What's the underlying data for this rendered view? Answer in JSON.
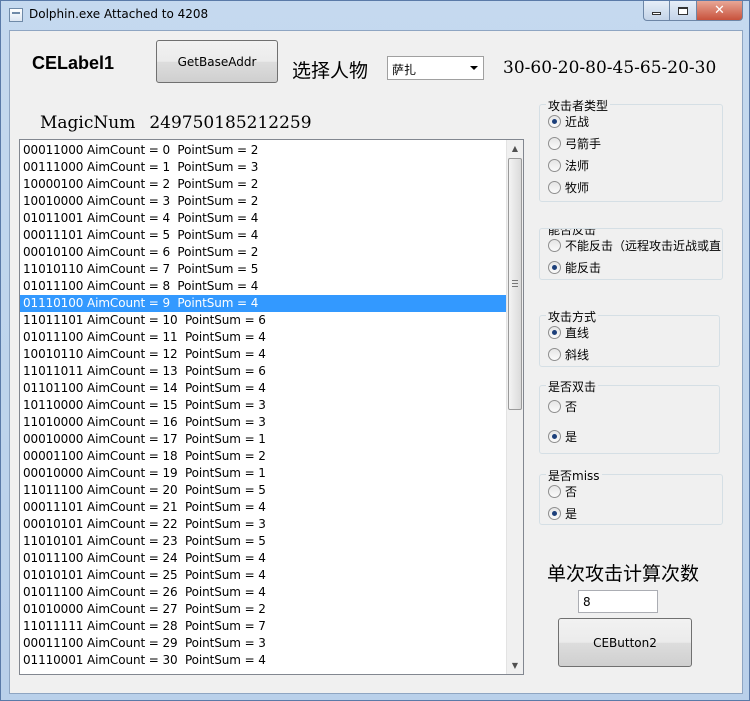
{
  "window": {
    "title": "Dolphin.exe Attached to 4208"
  },
  "header": {
    "celabel": "CELabel1",
    "getbase_button": "GetBaseAddr",
    "select_label": "选择人物",
    "combo_value": "萨扎",
    "number_string": "30-60-20-80-45-65-20-30"
  },
  "magic": {
    "label": "MagicNum",
    "value": "249750185212259"
  },
  "list": {
    "selected_index": 9,
    "rows": [
      "00011000 AimCount = 0  PointSum = 2",
      "00111000 AimCount = 1  PointSum = 3",
      "10000100 AimCount = 2  PointSum = 2",
      "10010000 AimCount = 3  PointSum = 2",
      "01011001 AimCount = 4  PointSum = 4",
      "00011101 AimCount = 5  PointSum = 4",
      "00010100 AimCount = 6  PointSum = 2",
      "11010110 AimCount = 7  PointSum = 5",
      "01011100 AimCount = 8  PointSum = 4",
      "01110100 AimCount = 9  PointSum = 4",
      "11011101 AimCount = 10  PointSum = 6",
      "01011100 AimCount = 11  PointSum = 4",
      "10010110 AimCount = 12  PointSum = 4",
      "11011011 AimCount = 13  PointSum = 6",
      "01101100 AimCount = 14  PointSum = 4",
      "10110000 AimCount = 15  PointSum = 3",
      "11010000 AimCount = 16  PointSum = 3",
      "00010000 AimCount = 17  PointSum = 1",
      "00001100 AimCount = 18  PointSum = 2",
      "00010000 AimCount = 19  PointSum = 1",
      "11011100 AimCount = 20  PointSum = 5",
      "00011101 AimCount = 21  PointSum = 4",
      "00010101 AimCount = 22  PointSum = 3",
      "11010101 AimCount = 23  PointSum = 5",
      "01011100 AimCount = 24  PointSum = 4",
      "01010101 AimCount = 25  PointSum = 4",
      "01011100 AimCount = 26  PointSum = 4",
      "01010000 AimCount = 27  PointSum = 2",
      "11011111 AimCount = 28  PointSum = 7",
      "00011100 AimCount = 29  PointSum = 3",
      "01110001 AimCount = 30  PointSum = 4"
    ]
  },
  "groups": {
    "attacker_type": {
      "title": "攻击者类型",
      "options": [
        "近战",
        "弓箭手",
        "法师",
        "牧师"
      ],
      "selected": 0
    },
    "counter": {
      "title": "能否反击",
      "options": [
        "不能反击（远程攻击近战或直",
        "能反击"
      ],
      "selected": 1
    },
    "attack_mode": {
      "title": "攻击方式",
      "options": [
        "直线",
        "斜线"
      ],
      "selected": 0
    },
    "double_hit": {
      "title": "是否双击",
      "options": [
        "否",
        "是"
      ],
      "selected": 1
    },
    "miss": {
      "title": "是否miss",
      "options": [
        "否",
        "是"
      ],
      "selected": 1
    }
  },
  "calc": {
    "label": "单次攻击计算次数",
    "count": "8",
    "button": "CEButton2"
  }
}
